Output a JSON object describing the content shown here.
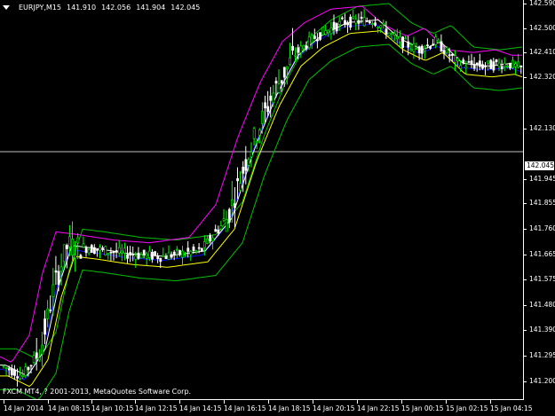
{
  "header": {
    "symbol": "EURJPY,M15",
    "open": "141.910",
    "high": "142.056",
    "low": "141.904",
    "close": "142.045"
  },
  "copyright": "FXCM MT4, ? 2001-2013, MetaQuotes Software Corp.",
  "colors": {
    "background": "#000000",
    "bull_candle": "#00ff00",
    "bear_candle": "#ffffff",
    "ma_white": "#ffffff",
    "ma_yellow": "#ffff00",
    "ma_magenta": "#ff00ff",
    "ma_green": "#00c000",
    "ma_blue": "#1010ff",
    "price_line": "#c0c0c0"
  },
  "chart_data": {
    "type": "candlestick",
    "current_price": "142.045",
    "y_ticks": [
      "142.590",
      "142.500",
      "142.410",
      "142.320",
      "142.130",
      "141.945",
      "141.855",
      "141.760",
      "141.665",
      "141.575",
      "141.480",
      "141.390",
      "141.295",
      "141.200"
    ],
    "ylim": [
      141.16,
      142.63
    ],
    "x_ticks": [
      "14 Jan 2014",
      "14 Jan 08:15",
      "14 Jan 10:15",
      "14 Jan 12:15",
      "14 Jan 14:15",
      "14 Jan 16:15",
      "14 Jan 18:15",
      "14 Jan 20:15",
      "14 Jan 22:15",
      "15 Jan 00:15",
      "15 Jan 02:15",
      "15 Jan 04:15"
    ]
  }
}
